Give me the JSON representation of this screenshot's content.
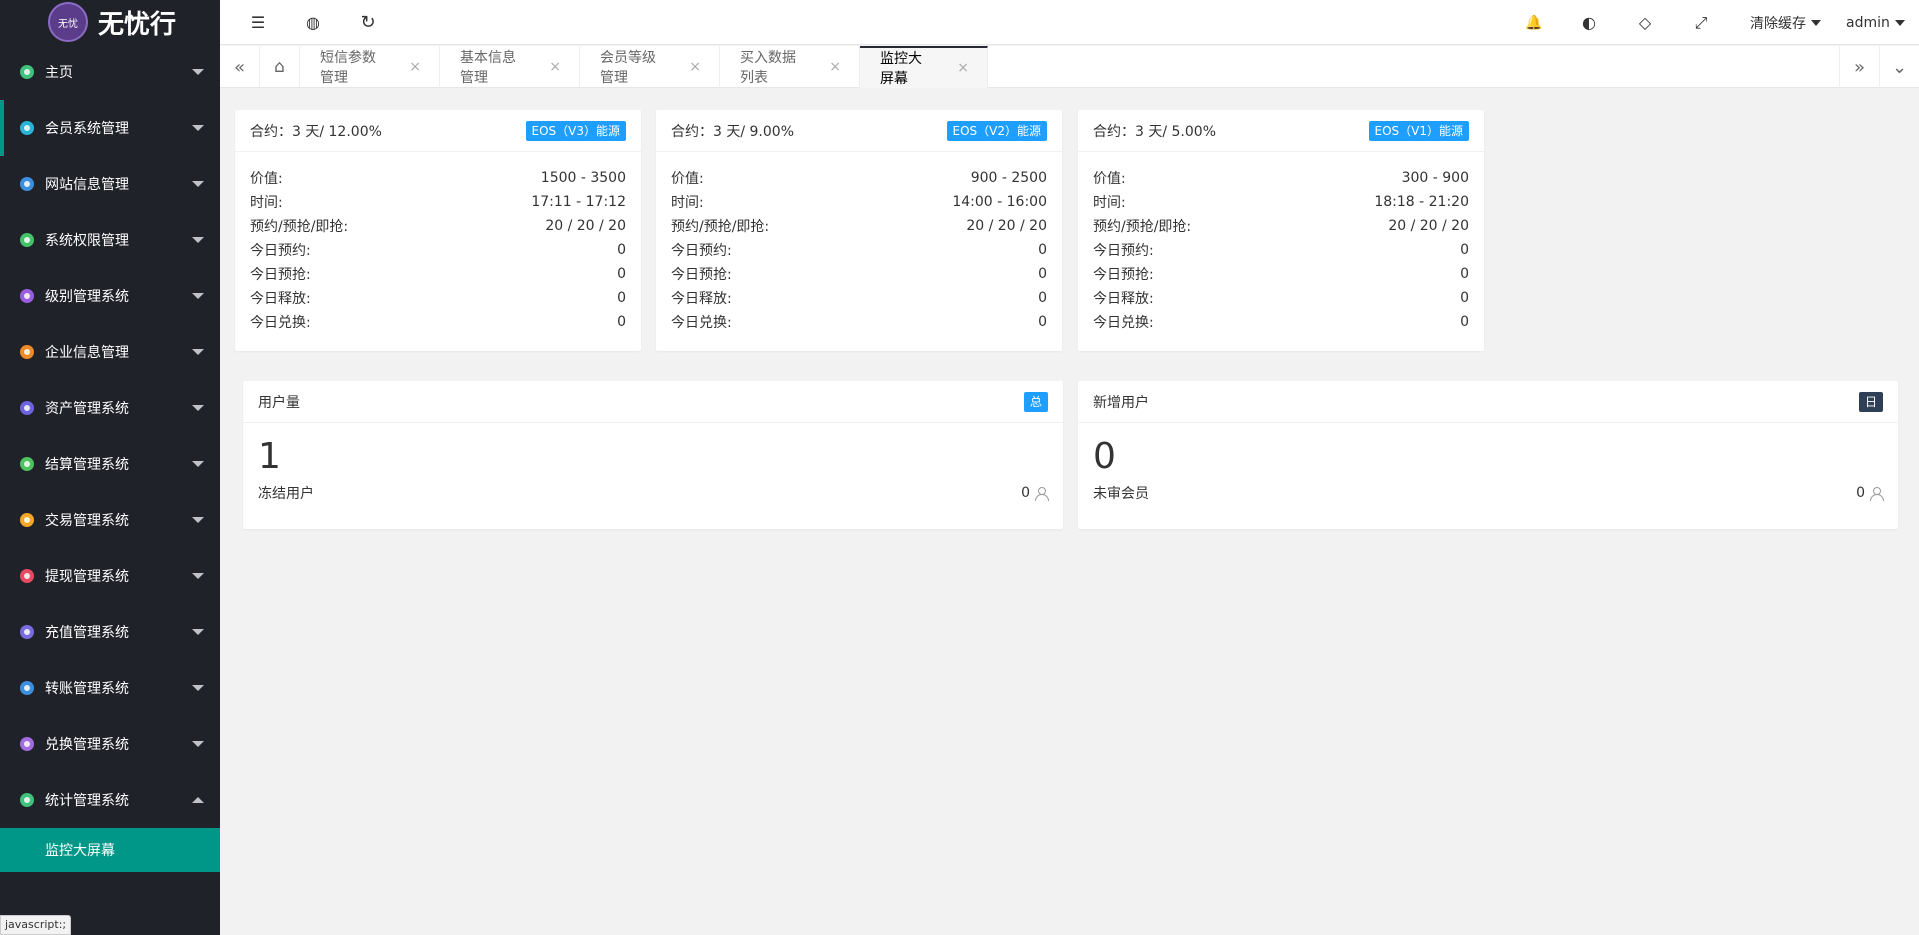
{
  "app": {
    "logo_mark": "无忧",
    "logo_text": "无忧行"
  },
  "colors": {
    "accent": "#009688",
    "badge_blue": "#1e9fff",
    "badge_dark": "#2f4056",
    "sidebar_bg": "#20222a"
  },
  "sidebar": {
    "items": [
      {
        "label": "主页",
        "icon": "home-icon",
        "color": "#3ec27d"
      },
      {
        "label": "会员系统管理",
        "icon": "member-icon",
        "color": "#28b5d8"
      },
      {
        "label": "网站信息管理",
        "icon": "globe-icon",
        "color": "#3b8fe0"
      },
      {
        "label": "系统权限管理",
        "icon": "permission-icon",
        "color": "#45c36a"
      },
      {
        "label": "级别管理系统",
        "icon": "level-icon",
        "color": "#9a5ce0"
      },
      {
        "label": "企业信息管理",
        "icon": "enterprise-icon",
        "color": "#f08a24"
      },
      {
        "label": "资产管理系统",
        "icon": "asset-icon",
        "color": "#6b63e0"
      },
      {
        "label": "结算管理系统",
        "icon": "settlement-icon",
        "color": "#4cc35c"
      },
      {
        "label": "交易管理系统",
        "icon": "trade-icon",
        "color": "#f5a623"
      },
      {
        "label": "提现管理系统",
        "icon": "withdraw-icon",
        "color": "#e84a5f"
      },
      {
        "label": "充值管理系统",
        "icon": "recharge-icon",
        "color": "#7a6be0"
      },
      {
        "label": "转账管理系统",
        "icon": "transfer-icon",
        "color": "#3b8fe0"
      },
      {
        "label": "兑换管理系统",
        "icon": "exchange-icon",
        "color": "#a36be0"
      },
      {
        "label": "统计管理系统",
        "icon": "statistics-icon",
        "color": "#3ec27d"
      }
    ],
    "sub_active": "监控大屏幕"
  },
  "status_url": "javascript:;",
  "header": {
    "menu_icon": "☰",
    "globe_icon": "◍",
    "refresh_icon": "↻",
    "bell_icon": "🔔",
    "theme_icon": "◐",
    "tag_icon": "◇",
    "fullscreen_icon": "⤢",
    "clear_cache": "清除缓存",
    "user": "admin"
  },
  "tabs": {
    "left_btn": "«",
    "home_icon": "⌂",
    "right_btn": "»",
    "more_btn": "⌄",
    "close": "×",
    "items": [
      {
        "label": "短信参数管理"
      },
      {
        "label": "基本信息管理"
      },
      {
        "label": "会员等级管理"
      },
      {
        "label": "买入数据列表"
      },
      {
        "label": "监控大屏幕"
      }
    ]
  },
  "contracts": [
    {
      "title": "合约：3 天/ 12.00%",
      "badge": "EOS（V3）能源",
      "rows": [
        {
          "k": "价值:",
          "v": "1500 - 3500"
        },
        {
          "k": "时间:",
          "v": "17:11 - 17:12"
        },
        {
          "k": "预约/预抢/即抢:",
          "v": "20 / 20 / 20"
        },
        {
          "k": "今日预约:",
          "v": "0"
        },
        {
          "k": "今日预抢:",
          "v": "0"
        },
        {
          "k": "今日释放:",
          "v": "0"
        },
        {
          "k": "今日兑换:",
          "v": "0"
        }
      ]
    },
    {
      "title": "合约：3 天/ 9.00%",
      "badge": "EOS（V2）能源",
      "rows": [
        {
          "k": "价值:",
          "v": "900 - 2500"
        },
        {
          "k": "时间:",
          "v": "14:00 - 16:00"
        },
        {
          "k": "预约/预抢/即抢:",
          "v": "20 / 20 / 20"
        },
        {
          "k": "今日预约:",
          "v": "0"
        },
        {
          "k": "今日预抢:",
          "v": "0"
        },
        {
          "k": "今日释放:",
          "v": "0"
        },
        {
          "k": "今日兑换:",
          "v": "0"
        }
      ]
    },
    {
      "title": "合约：3 天/ 5.00%",
      "badge": "EOS（V1）能源",
      "rows": [
        {
          "k": "价值:",
          "v": "300 - 900"
        },
        {
          "k": "时间:",
          "v": "18:18 - 21:20"
        },
        {
          "k": "预约/预抢/即抢:",
          "v": "20 / 20 / 20"
        },
        {
          "k": "今日预约:",
          "v": "0"
        },
        {
          "k": "今日预抢:",
          "v": "0"
        },
        {
          "k": "今日释放:",
          "v": "0"
        },
        {
          "k": "今日兑换:",
          "v": "0"
        }
      ]
    }
  ],
  "stats": [
    {
      "title": "用户量",
      "badge": "总",
      "value": "1",
      "foot_label": "冻结用户",
      "foot_value": "0"
    },
    {
      "title": "新增用户",
      "badge": "日",
      "value": "0",
      "foot_label": "未审会员",
      "foot_value": "0"
    }
  ]
}
